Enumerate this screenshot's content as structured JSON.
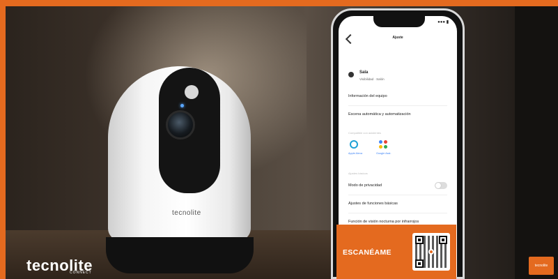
{
  "brand": {
    "name": "tecnolite",
    "sub": "CONNECT",
    "corner_text": "tecnolite"
  },
  "camera": {
    "logo": "tecnolite"
  },
  "phone": {
    "status": "●●● ▮",
    "nav_title": "Ajuste",
    "device": {
      "name": "Sala",
      "subtitle": "Visibilidad · Salón"
    },
    "rows": [
      "Información del equipo",
      "Escena automática y automatización"
    ],
    "section_assistants": "Compatible con asistentes",
    "assistants": [
      {
        "name": "Alexa",
        "label": "Apple Alexa"
      },
      {
        "name": "Google Assistant",
        "label": "Google Asst."
      }
    ],
    "section_settings": "Ajustes básicos",
    "rows2": [
      "Modo de privacidad",
      "Ajustes de funciones básicas",
      "Función de visión nocturna por infrarrojos"
    ],
    "privacy_toggle": false
  },
  "cta": {
    "label": "ESCANÉAME"
  },
  "colors": {
    "accent": "#e46a1f"
  }
}
